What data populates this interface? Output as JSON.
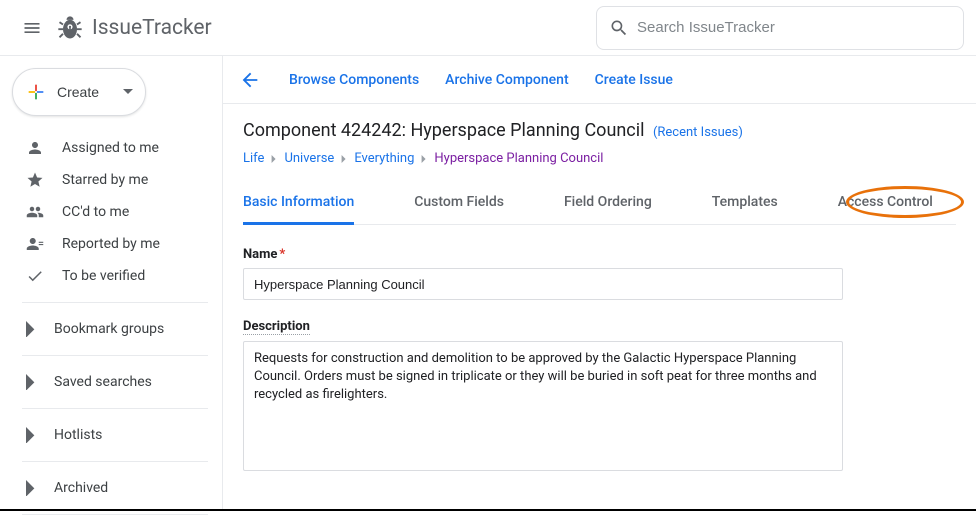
{
  "app": {
    "title": "IssueTracker",
    "search_placeholder": "Search IssueTracker"
  },
  "sidebar": {
    "create_label": "Create",
    "items": [
      {
        "label": "Assigned to me"
      },
      {
        "label": "Starred by me"
      },
      {
        "label": "CC'd to me"
      },
      {
        "label": "Reported by me"
      },
      {
        "label": "To be verified"
      }
    ],
    "groups": [
      {
        "label": "Bookmark groups"
      },
      {
        "label": "Saved searches"
      },
      {
        "label": "Hotlists"
      },
      {
        "label": "Archived"
      }
    ]
  },
  "actions": {
    "browse": "Browse Components",
    "archive": "Archive Component",
    "create_issue": "Create Issue"
  },
  "component": {
    "title": "Component 424242: Hyperspace Planning Council",
    "recent_link": "(Recent Issues)",
    "breadcrumb": [
      "Life",
      "Universe",
      "Everything",
      "Hyperspace Planning Council"
    ]
  },
  "tabs": [
    "Basic Information",
    "Custom Fields",
    "Field Ordering",
    "Templates",
    "Access Control"
  ],
  "form": {
    "name_label": "Name",
    "name_value": "Hyperspace Planning Council",
    "desc_label": "Description",
    "desc_value": "Requests for construction and demolition to be approved by the Galactic Hyperspace Planning Council. Orders must be signed in triplicate or they will be buried in soft peat for three months and recycled as firelighters."
  }
}
